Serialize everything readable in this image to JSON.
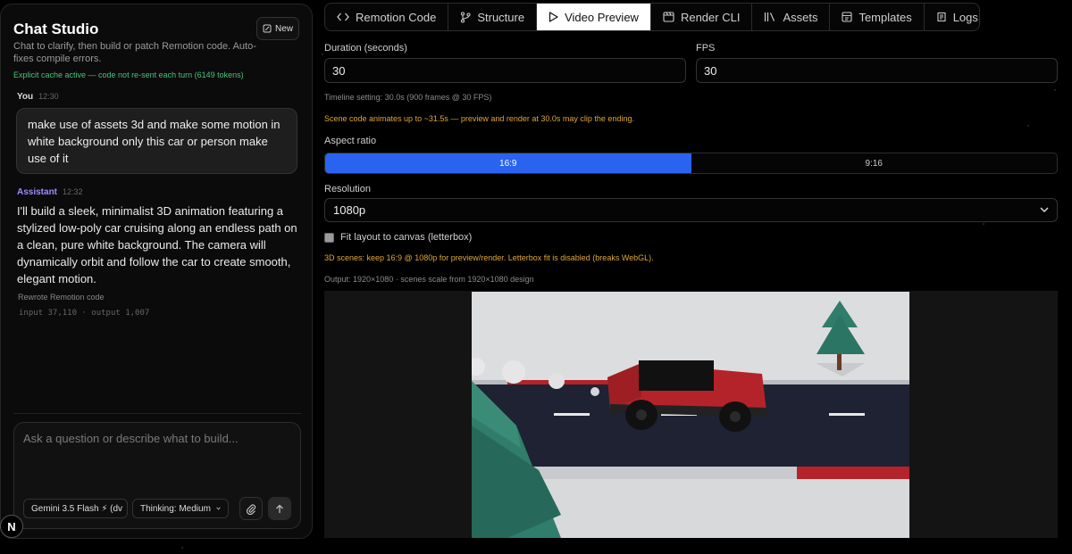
{
  "chat": {
    "title": "Chat Studio",
    "new_label": "New",
    "subtitle": "Chat to clarify, then build or patch Remotion code. Auto-fixes compile errors.",
    "cache_note": "Explicit cache active — code not re-sent each turn (6149 tokens)",
    "messages": [
      {
        "role": "You",
        "time": "12:30",
        "text": "make use of assets 3d and make some motion in white background only this car or person make use of it"
      },
      {
        "role": "Assistant",
        "time": "12:32",
        "text": "I'll build a sleek, minimalist 3D animation featuring a stylized low-poly car cruising along an endless path on a clean, pure white background. The camera will dynamically orbit and follow the car to create smooth, elegant motion.",
        "action": "Rewrote Remotion code",
        "tokens": "input 37,110 · output 1,007"
      }
    ],
    "composer": {
      "placeholder": "Ask a question or describe what to build...",
      "model": "Gemini 3.5 Flash ⚡ (dv",
      "thinking": "Thinking: Medium"
    },
    "badge": "N"
  },
  "tabs": [
    {
      "label": "Remotion Code",
      "icon": "code-icon",
      "active": false
    },
    {
      "label": "Structure",
      "icon": "branch-icon",
      "active": false
    },
    {
      "label": "Video Preview",
      "icon": "play-icon",
      "active": true
    },
    {
      "label": "Render CLI",
      "icon": "film-icon",
      "active": false
    },
    {
      "label": "Assets",
      "icon": "library-icon",
      "active": false
    },
    {
      "label": "Templates",
      "icon": "template-icon",
      "active": false
    },
    {
      "label": "Logs",
      "icon": "logs-icon",
      "active": false
    }
  ],
  "settings": {
    "duration_label": "Duration (seconds)",
    "duration_value": "30",
    "fps_label": "FPS",
    "fps_value": "30",
    "timeline_note": "Timeline setting: 30.0s (900 frames @ 30 FPS)",
    "scene_warning": "Scene code animates up to ~31.5s — preview and render at 30.0s may clip the ending.",
    "aspect_label": "Aspect ratio",
    "aspect_options": [
      "16:9",
      "9:16"
    ],
    "aspect_selected": "16:9",
    "resolution_label": "Resolution",
    "resolution_value": "1080p",
    "fit_label": "Fit layout to canvas (letterbox)",
    "fit_checked": false,
    "scenes_warning": "3D scenes: keep 16:9 @ 1080p for preview/render. Letterbox fit is disabled (breaks WebGL).",
    "output_note": "Output: 1920×1080 · scenes scale from 1920×1080 design"
  },
  "colors": {
    "accent_blue": "#2a63f0",
    "warning": "#e0a632",
    "success": "#4ac37a",
    "assistant": "#9d8cff",
    "car_red": "#b5232a",
    "road": "#1e2233",
    "tree": "#2f7d6a"
  }
}
